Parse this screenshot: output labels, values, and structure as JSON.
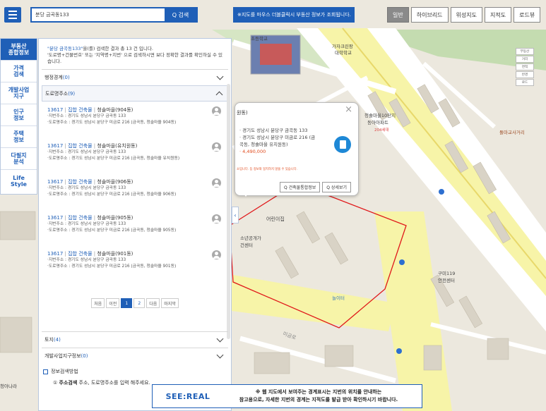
{
  "search": {
    "value": "분당 금곡동133",
    "button": "Q 검색"
  },
  "notice_bar": "※지도를 마우스 더블클릭시 부동산 정보가 조회됩니다.",
  "map_tabs": [
    {
      "label": "일반",
      "active": true
    },
    {
      "label": "하이브리드"
    },
    {
      "label": "위성지도"
    },
    {
      "label": "지적도"
    },
    {
      "label": "로드뷰"
    }
  ],
  "categories": [
    {
      "label": "부동산\n종합정보",
      "active": true
    },
    {
      "label": "가격\n검색"
    },
    {
      "label": "개발사업\n지구"
    },
    {
      "label": "인구\n정보"
    },
    {
      "label": "주택\n정보"
    },
    {
      "label": "다필지\n분석"
    },
    {
      "label": "Life\nStyle"
    }
  ],
  "summary": {
    "keyword": "\"분당 금곡동133\"",
    "line1": "을(를) 검색한 결과 총 13 건 입니다.",
    "line2": "'도로명+건물번호' 또는 '지역명+지번' 으로 검색하시면 보다 정확한 결과를 확인하실 수 있습니다."
  },
  "sections": {
    "admin": {
      "label": "행정경계",
      "count": "(0)"
    },
    "road": {
      "label": "도로명주소",
      "count": "(9)"
    },
    "land": {
      "label": "토지",
      "count": "(4)"
    },
    "dev": {
      "label": "개발사업지구정보",
      "count": "(0)"
    }
  },
  "results": [
    {
      "code": "13617",
      "type": "집합 건축물",
      "name": "청솔마을(904동)",
      "jibun": "·지번주소 : 경기도 성남시 분당구 금곡동 133",
      "road": "·도로명주소 : 경기도 성남시 분당구 미금로 216 (금곡동, 청솔마을 904동)"
    },
    {
      "code": "13617",
      "type": "집합 건축물",
      "name": "청솔마을(유치원동)",
      "jibun": "·지번주소 : 경기도 성남시 분당구 금곡동 133",
      "road": "·도로명주소 : 경기도 성남시 분당구 미금로 216 (금곡동, 청솔마을 유치원동)"
    },
    {
      "code": "13617",
      "type": "집합 건축물",
      "name": "청솔마을(906동)",
      "jibun": "·지번주소 : 경기도 성남시 분당구 금곡동 133",
      "road": "·도로명주소 : 경기도 성남시 분당구 미금로 216 (금곡동, 청솔마을 906동)"
    },
    {
      "code": "13617",
      "type": "집합 건축물",
      "name": "청솔마을(905동)",
      "jibun": "·지번주소 : 경기도 성남시 분당구 금곡동 133",
      "road": "·도로명주소 : 경기도 성남시 분당구 미금로 216 (금곡동, 청솔마을 905동)"
    },
    {
      "code": "13617",
      "type": "집합 건축물",
      "name": "청솔마을(901동)",
      "jibun": "·지번주소 : 경기도 성남시 분당구 금곡동 133",
      "road": "·도로명주소 : 경기도 성남시 분당구 미금로 216 (금곡동, 청솔마을 901동)"
    }
  ],
  "pager": {
    "first": "처음",
    "prev": "이전",
    "pages": [
      "1",
      "2"
    ],
    "current": "1",
    "next": "다음",
    "last": "마지막"
  },
  "guide": {
    "title": "정보검색방법",
    "step_no": "①",
    "step_bold": "주소검색",
    "step_text": " 주소, 도로명주소를 입력 해주세요."
  },
  "popup": {
    "title": "원동)",
    "line1": "·  경기도 성남시 분당구 금곡동 133",
    "line2": "·  경기도 성남시 분당구 미금로 216 (금",
    "line3": "    곡동, 청솔마을 유치원동)",
    "price": "·  4,490,000",
    "note": "소입니다. 등 정보와 일치하지 않을 수 있습니다.",
    "btn_building": "Q 건축물통합정보",
    "btn_detail": "Q 상세보기"
  },
  "bottom_notice": {
    "logo": "SEE:REAL",
    "line1": "※ 웹 지도에서 보여주는 경계표시는 지번의 위치를 안내하는",
    "line2": "참고용으로, 자세한 지번의 경계는 지적도를 발급 받아 확인하시기 바랍니다."
  },
  "map_labels": {
    "school_name": "가자크린팡\n대학학교",
    "apt_name": "청솔마을10단지\n동아아파트",
    "apt_units": "204세대",
    "intersection": "돌마교사거리",
    "daycare": "어린이집",
    "kids": "놀이터",
    "firestation": "구미119\n안전센터",
    "road_name": "미금로",
    "community": "소년공개가\n건센터",
    "bus": "초등학교",
    "children": "청아나라"
  },
  "right_tools": [
    "부동산",
    "거리",
    "면적",
    "반경",
    "로드",
    "",
    "국가"
  ],
  "colors": {
    "brand": "#1f5fb7",
    "accent_red": "#e04a1c",
    "parcel_line": "#e0181a"
  }
}
